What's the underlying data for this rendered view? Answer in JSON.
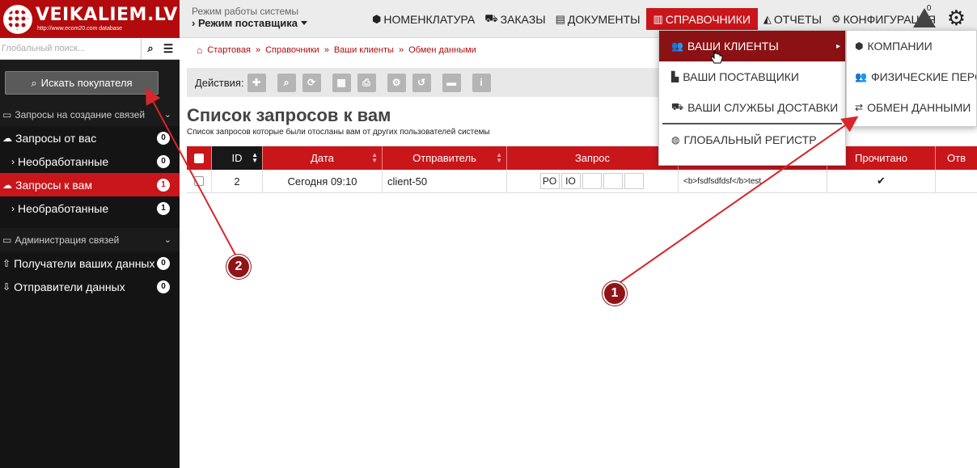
{
  "logo": {
    "title": "VEIKALIEM.LV",
    "subtitle": "http://www.ecom20.com database"
  },
  "mode": {
    "label": "Режим работы системы",
    "value": "Режим поставщика"
  },
  "topnav": [
    {
      "icon": "cubes-icon",
      "glyph": "⬢",
      "label": "НОМЕНКЛАТУРА"
    },
    {
      "icon": "basket-icon",
      "glyph": "🛒",
      "label": "ЗАКАЗЫ"
    },
    {
      "icon": "document-icon",
      "glyph": "📄",
      "label": "ДОКУМЕНТЫ"
    },
    {
      "icon": "book-icon",
      "glyph": "📕",
      "label": "СПРАВОЧНИКИ"
    },
    {
      "icon": "chart-icon",
      "glyph": "📈",
      "label": "ОТЧЕТЫ"
    },
    {
      "icon": "gears-icon",
      "glyph": "⚙",
      "label": "КОНФИГУРАЦИЯ"
    }
  ],
  "notifications": {
    "count": "0"
  },
  "sidebar": {
    "search_placeholder": "Глобальный поиск...",
    "find_button": "Искать покупателя",
    "section1": "Запросы на создание связей",
    "items1": [
      {
        "label": "Запросы от вас",
        "count": "0"
      },
      {
        "label": "Необработанные",
        "count": "0"
      },
      {
        "label": "Запросы к вам",
        "count": "1"
      },
      {
        "label": "Необработанные",
        "count": "1"
      }
    ],
    "section2": "Администрация связей",
    "items2": [
      {
        "label": "Получатели ваших данных",
        "count": "0"
      },
      {
        "label": "Отправители данных",
        "count": "0"
      }
    ]
  },
  "breadcrumb": [
    "Стартовая",
    "Справочники",
    "Ваши клиенты",
    "Обмен данными"
  ],
  "actions_label": "Действия:",
  "page": {
    "title": "Список запросов к вам",
    "description": "Список запросов которые были отосланы вам от других пользователей системы"
  },
  "table": {
    "headers": [
      "ID",
      "Дата",
      "Отправитель",
      "Запрос",
      "",
      "Прочитано",
      "Отв"
    ],
    "rows": [
      {
        "id": "2",
        "date": "Сегодня 09:10",
        "sender": "client-50",
        "req1": "PO",
        "req2": "IO",
        "message": "<b>fsdfsdfdsf</b>test",
        "read": "✔"
      }
    ]
  },
  "dropdown": [
    {
      "label": "ВАШИ КЛИЕНТЫ"
    },
    {
      "label": "ВАШИ ПОСТАВЩИКИ"
    },
    {
      "label": "ВАШИ СЛУЖБЫ ДОСТАВКИ"
    },
    {
      "label": "ГЛОБАЛЬНЫЙ РЕГИСТР"
    }
  ],
  "submenu": [
    {
      "label": "КОМПАНИИ"
    },
    {
      "label": "ФИЗИЧЕСКИЕ ПЕРСОНЫ"
    },
    {
      "label": "ОБМЕН ДАННЫМИ"
    }
  ],
  "annotations": {
    "marker1": "1",
    "marker2": "2"
  },
  "colors": {
    "brand": "#b30b0d",
    "active": "#c8161b",
    "dropdown_active": "#8a1214"
  }
}
